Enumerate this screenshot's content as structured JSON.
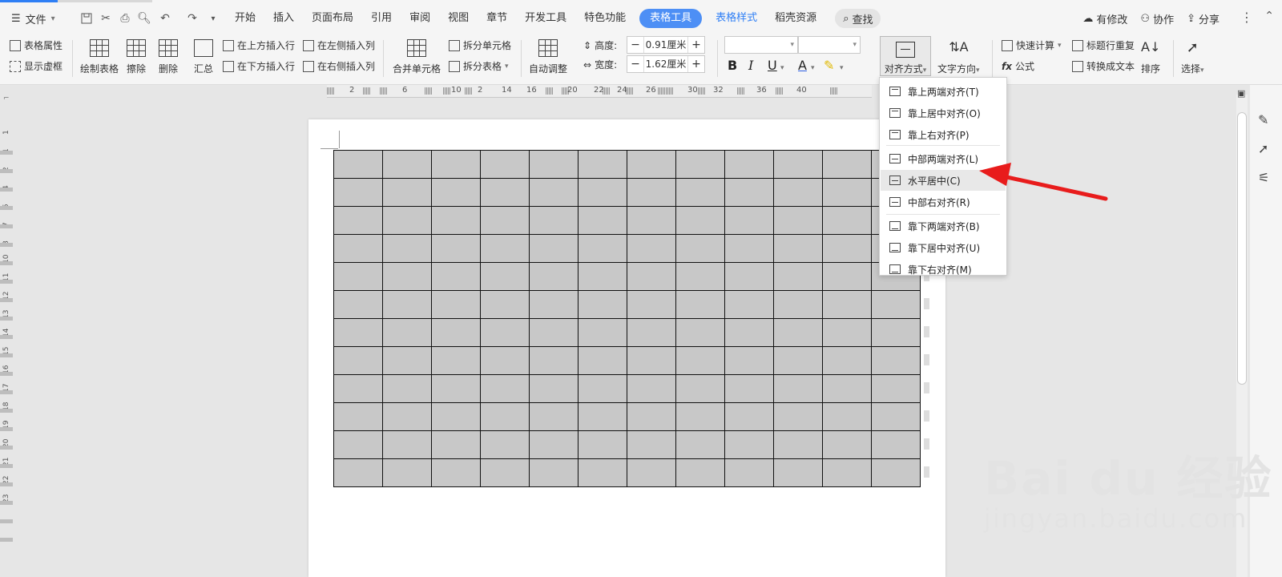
{
  "topbar": {
    "file_label": "文件",
    "tabs": [
      "开始",
      "插入",
      "页面布局",
      "引用",
      "审阅",
      "视图",
      "章节",
      "开发工具",
      "特色功能",
      "表格工具",
      "表格样式",
      "稻壳资源"
    ],
    "active_tab": "表格工具",
    "search_label": "查找",
    "right_actions": [
      "有修改",
      "协作",
      "分享"
    ]
  },
  "ribbon": {
    "table_props": "表格属性",
    "show_gridlines": "显示虚框",
    "draw_table": "绘制表格",
    "erase": "擦除",
    "delete": "删除",
    "summary": "汇总",
    "insert_above": "在上方插入行",
    "insert_below": "在下方插入行",
    "insert_left": "在左侧插入列",
    "insert_right": "在右侧插入列",
    "merge_cells": "合并单元格",
    "split_cells": "拆分单元格",
    "split_table": "拆分表格",
    "auto_fit": "自动调整",
    "height_label": "高度:",
    "height_value": "0.91厘米",
    "width_label": "宽度:",
    "width_value": "1.62厘米",
    "align": "对齐方式",
    "text_direction": "文字方向",
    "quick_calc": "快速计算",
    "repeat_header": "标题行重复",
    "convert_text": "转换成文本",
    "formula": "公式",
    "sort": "排序",
    "select": "选择"
  },
  "ruler": {
    "h_numbers": [
      "2",
      "6",
      "10",
      "2",
      "14",
      "16",
      "20",
      "22",
      "24",
      "26",
      "30",
      "32",
      "36",
      "40"
    ],
    "v_numbers": [
      "1",
      "1",
      "2",
      "4",
      "5",
      "7",
      "8",
      "10",
      "11",
      "12",
      "13",
      "14",
      "15",
      "16",
      "17",
      "18",
      "19",
      "20",
      "21",
      "22",
      "23"
    ]
  },
  "table": {
    "rows": 12,
    "cols": 12
  },
  "dropdown": {
    "items": [
      {
        "label": "靠上两端对齐(T)",
        "pos": "t"
      },
      {
        "label": "靠上居中对齐(O)",
        "pos": "t"
      },
      {
        "label": "靠上右对齐(P)",
        "pos": "t"
      },
      {
        "label": "中部两端对齐(L)",
        "pos": "m"
      },
      {
        "label": "水平居中(C)",
        "pos": "m"
      },
      {
        "label": "中部右对齐(R)",
        "pos": "m"
      },
      {
        "label": "靠下两端对齐(B)",
        "pos": "b"
      },
      {
        "label": "靠下居中对齐(U)",
        "pos": "b"
      },
      {
        "label": "靠下右对齐(M)",
        "pos": "b"
      }
    ],
    "selected_index": 4
  },
  "watermark": {
    "main": "Bai du 经验",
    "sub": "jingyan.baidu.com"
  },
  "colors": {
    "accent": "#4d8ff5",
    "arrow": "#e81c1c",
    "cell": "#c8c8c8"
  }
}
